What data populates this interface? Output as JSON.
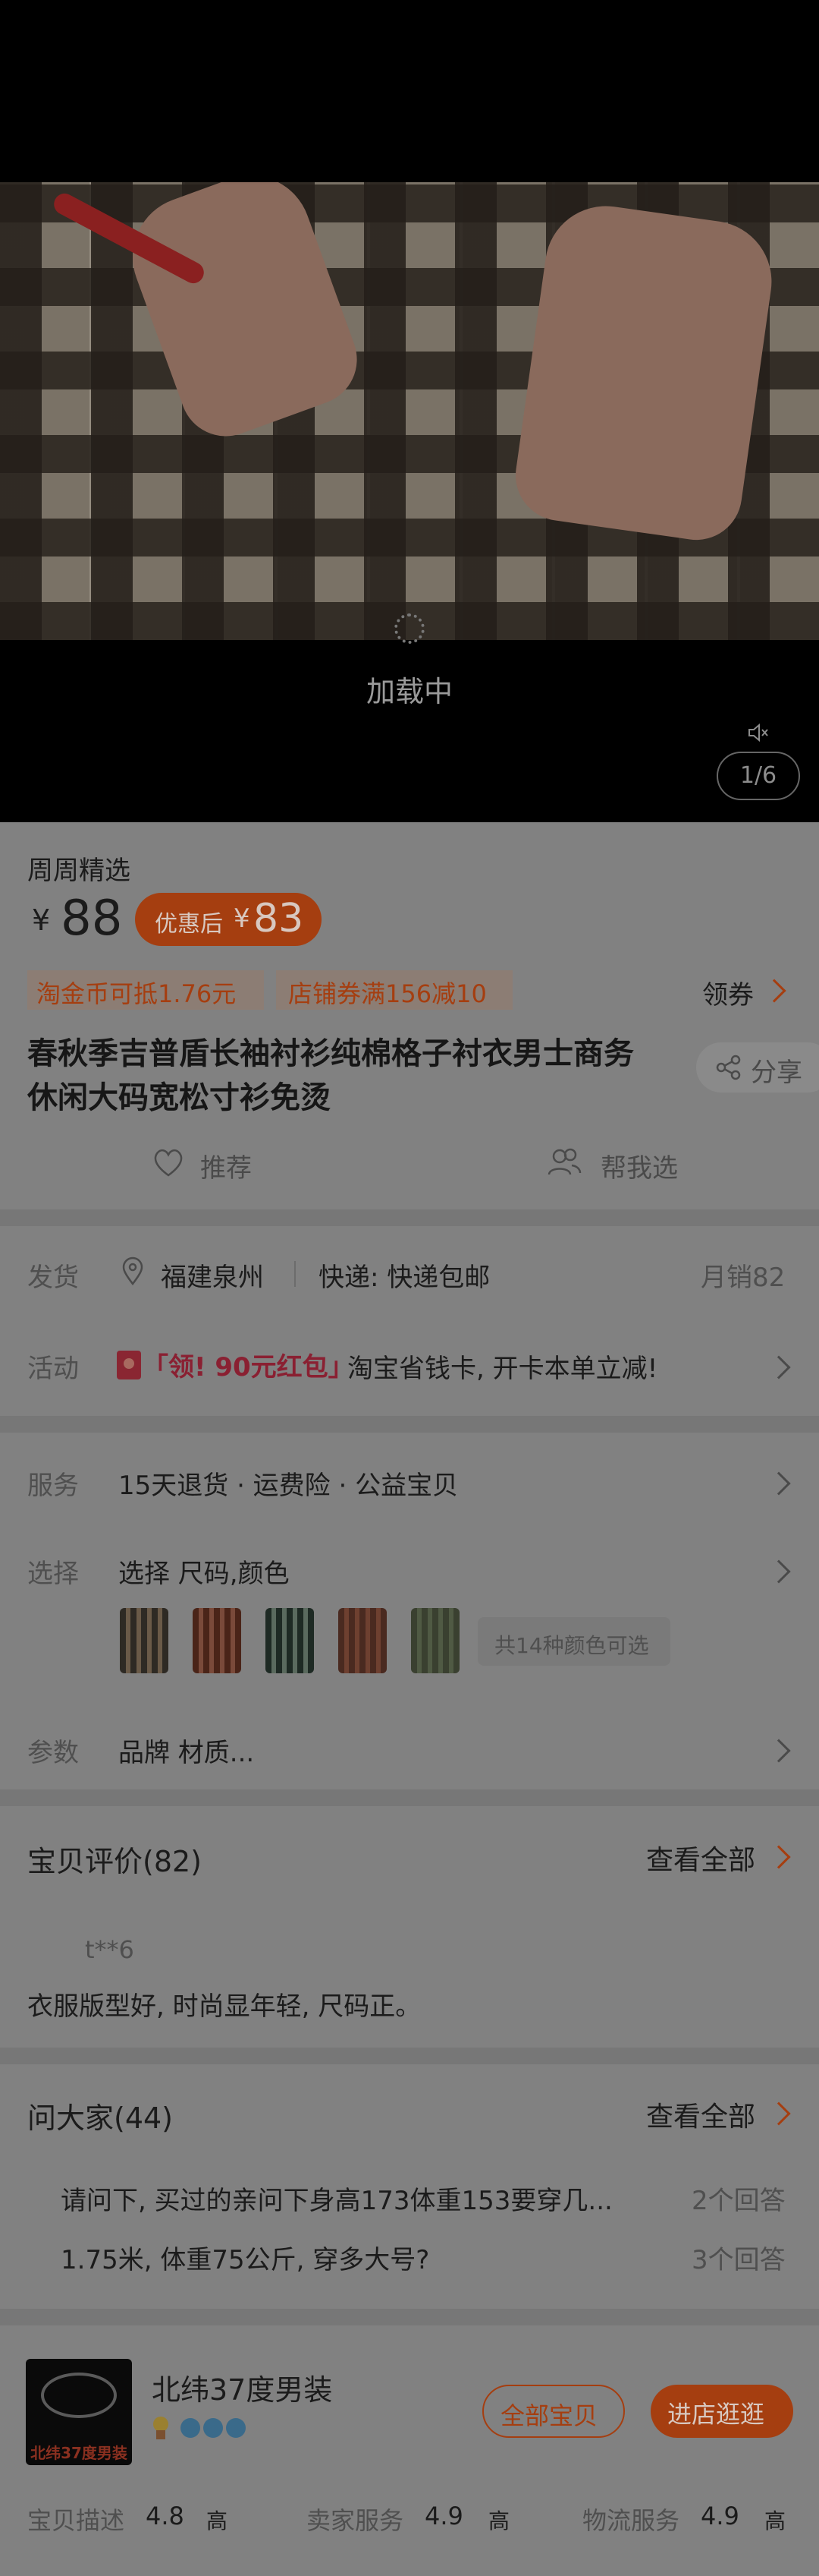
{
  "video": {
    "loading": "加载中",
    "pager": "1/6"
  },
  "product": {
    "tag": "周周精选",
    "currency": "¥",
    "price": "88",
    "after_label": "优惠后",
    "after_currency": "¥",
    "after_price": "83",
    "promo1": "淘金币可抵1.76元",
    "promo2": "店铺券满156减10",
    "coupon": "领券",
    "title_line1": "春秋季吉普盾长袖衬衫纯棉格子衬衣男士商务",
    "title_line2": "休闲大码宽松寸衫免烫",
    "share": "分享",
    "recommend": "推荐",
    "help_choose": "帮我选"
  },
  "shipping": {
    "label": "发货",
    "location": "福建泉州",
    "express": "快递: 快递包邮",
    "monthly_sales": "月销82"
  },
  "activity": {
    "label": "活动",
    "badge": "「领! 90元红包」",
    "text": "淘宝省钱卡, 开卡本单立减!"
  },
  "service": {
    "label": "服务",
    "text": "15天退货 · 运费险 · 公益宝贝"
  },
  "choose": {
    "label": "选择",
    "text": "选择 尺码,颜色",
    "colors_count": "共14种颜色可选"
  },
  "params": {
    "label": "参数",
    "text": "品牌 材质..."
  },
  "reviews": {
    "title": "宝贝评价(82)",
    "view_all": "查看全部",
    "user": "t**6",
    "content": "衣服版型好, 时尚显年轻, 尺码正。"
  },
  "qa": {
    "title": "问大家(44)",
    "view_all": "查看全部",
    "items": [
      {
        "q": "请问下, 买过的亲问下身高173体重153要穿几...",
        "count": "2个回答"
      },
      {
        "q": "1.75米, 体重75公斤, 穿多大号?",
        "count": "3个回答"
      }
    ]
  },
  "shop": {
    "logo_text": "北纬37度男装",
    "name": "北纬37度男装",
    "all_items": "全部宝贝",
    "enter": "进店逛逛",
    "ratings": [
      {
        "label": "宝贝描述",
        "score": "4.8",
        "level": "高"
      },
      {
        "label": "卖家服务",
        "score": "4.9",
        "level": "高"
      },
      {
        "label": "物流服务",
        "score": "4.9",
        "level": "高"
      }
    ]
  },
  "colors": {
    "accent": "#a53e10",
    "overlay_bg": "#818181"
  }
}
